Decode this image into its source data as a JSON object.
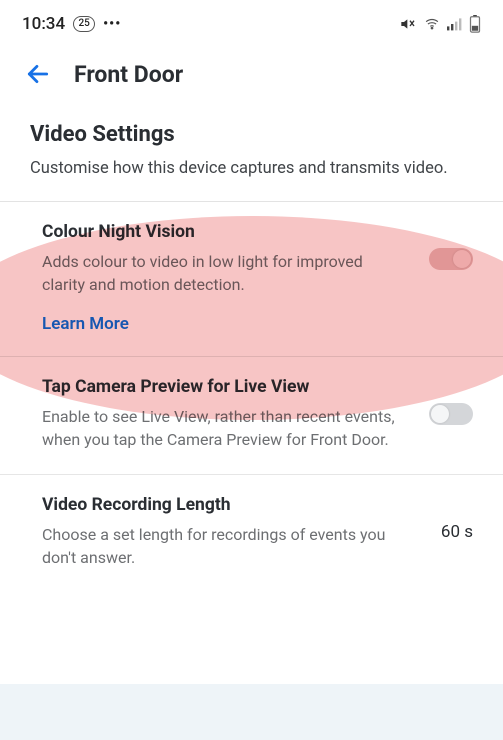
{
  "statusbar": {
    "time": "10:34",
    "badge": "25",
    "dots": "•••"
  },
  "header": {
    "title": "Front Door"
  },
  "section": {
    "title": "Video Settings",
    "subtitle": "Customise how this device captures and transmits video."
  },
  "settings": {
    "colourNightVision": {
      "title": "Colour Night Vision",
      "desc": "Adds colour to video in low light for improved clarity and motion detection.",
      "link": "Learn More",
      "enabled": true
    },
    "tapPreview": {
      "title": "Tap Camera Preview for Live View",
      "desc": "Enable to see Live View, rather than recent events, when you tap the Camera Preview for Front Door.",
      "enabled": false
    },
    "recordingLength": {
      "title": "Video Recording Length",
      "desc": "Choose a set length for recordings of events you don't answer.",
      "value": "60 s"
    }
  }
}
